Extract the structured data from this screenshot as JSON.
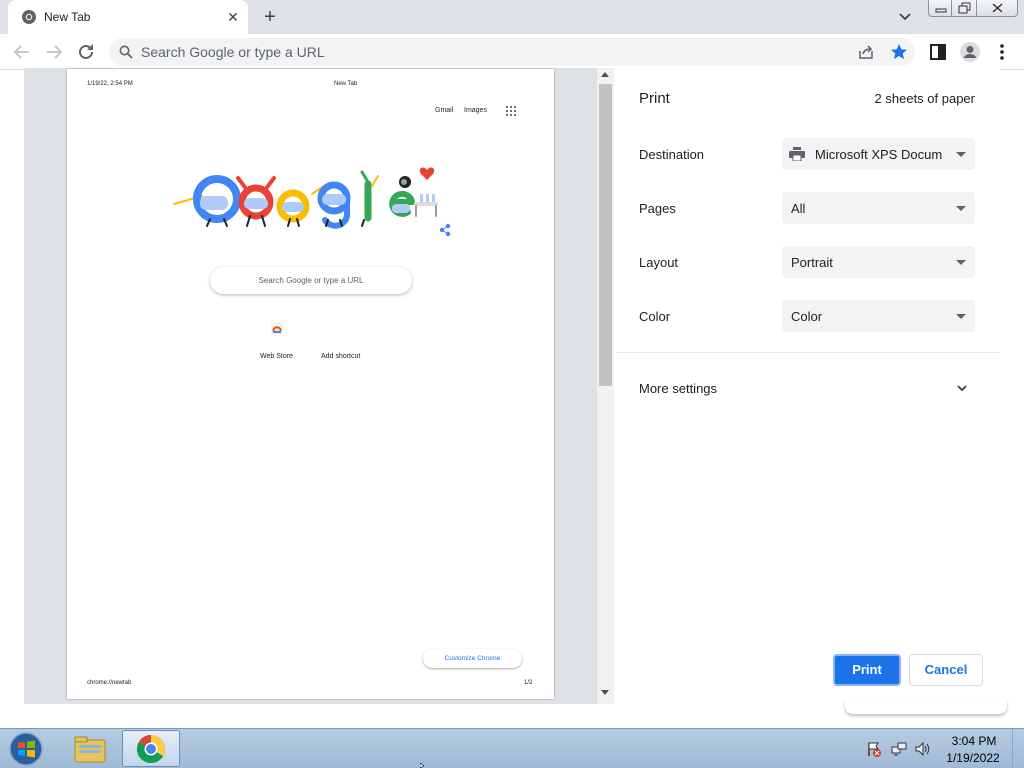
{
  "browser": {
    "tab": {
      "title": "New Tab",
      "close_glyph": "✕"
    },
    "new_tab_glyph": "+",
    "omnibox": {
      "placeholder": "Search Google or type a URL",
      "value": ""
    }
  },
  "preview": {
    "header_date": "1/19/22, 2:54 PM",
    "header_title": "New Tab",
    "footer_url": "chrome://newtab",
    "footer_page": "1/2",
    "page": {
      "gmail": "Gmail",
      "images": "Images",
      "search_placeholder": "Search Google or type a URL",
      "shortcut_webstore": "Web Store",
      "shortcut_add": "Add shortcut",
      "customize": "Customize Chrome"
    }
  },
  "settings": {
    "title": "Print",
    "sheets": "2 sheets of paper",
    "rows": [
      {
        "label": "Destination",
        "value": "Microsoft XPS Docum"
      },
      {
        "label": "Pages",
        "value": "All"
      },
      {
        "label": "Layout",
        "value": "Portrait"
      },
      {
        "label": "Color",
        "value": "Color"
      }
    ],
    "more_settings": "More settings",
    "print_button": "Print",
    "cancel_button": "Cancel"
  },
  "taskbar": {
    "time": "3:04 PM",
    "date": "1/19/2022"
  },
  "colors": {
    "accent": "#1a73e8",
    "star": "#1a73e8",
    "tab_strip": "#dee1e6",
    "preview_bg": "#dee1e6"
  },
  "icons": [
    "chrome-icon",
    "close-icon",
    "plus-icon",
    "chevron-down-icon",
    "back-icon",
    "forward-icon",
    "reload-icon",
    "search-icon",
    "share-icon",
    "star-icon",
    "side-panel-icon",
    "profile-icon",
    "kebab-menu-icon",
    "printer-icon",
    "apps-grid-icon",
    "windows-start-icon",
    "folder-icon",
    "flag-icon",
    "network-icon",
    "volume-icon"
  ]
}
